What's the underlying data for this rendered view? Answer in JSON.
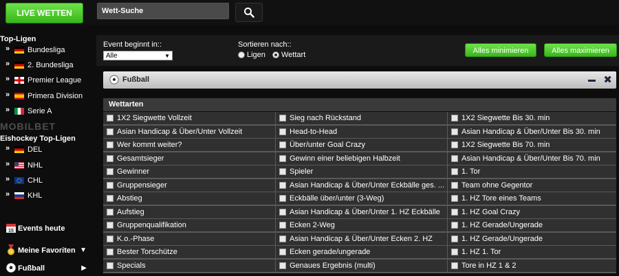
{
  "header": {
    "live_label": "LIVE WETTEN",
    "search_value": "Wett-Suche"
  },
  "sidebar": {
    "top_title": "Top-Ligen",
    "top_items": [
      {
        "label": "Bundesliga",
        "flag": "germany"
      },
      {
        "label": "2. Bundesliga",
        "flag": "germany"
      },
      {
        "label": "Premier League",
        "flag": "england"
      },
      {
        "label": "Primera Division",
        "flag": "spain"
      },
      {
        "label": "Serie A",
        "flag": "italy"
      }
    ],
    "watermark": "MOBILBET",
    "hockey_title": "Eishockey Top-Ligen",
    "hockey_items": [
      {
        "label": "DEL",
        "flag": "germany"
      },
      {
        "label": "NHL",
        "flag": "usa"
      },
      {
        "label": "CHL",
        "flag": "europe"
      },
      {
        "label": "KHL",
        "flag": "russia"
      }
    ],
    "events_today": "Events heute",
    "favorites": "Meine Favoriten",
    "football": "Fußball"
  },
  "filter": {
    "event_label": "Event beginnt in::",
    "event_value": "Alle",
    "sort_label": "Sortieren nach::",
    "radio_ligen": "Ligen",
    "radio_wettart": "Wettart",
    "selected_sort": "Wettart",
    "minimize_all": "Alles minimieren",
    "maximize_all": "Alles maximieren"
  },
  "panel": {
    "title": "Fußball",
    "section_header": "Wettarten",
    "columns": [
      [
        "1X2 Siegwette Vollzeit",
        "Asian Handicap & Über/Unter Vollzeit",
        "Wer kommt weiter?",
        "Gesamtsieger",
        "Gewinner",
        "Gruppensieger",
        "Abstieg",
        "Aufstieg",
        "Gruppenqualifikation",
        "K.o.-Phase",
        "Bester Torschütze",
        "Specials"
      ],
      [
        "Sieg nach Rückstand",
        "Head-to-Head",
        "Über/unter Goal Crazy",
        "Gewinn einer beliebigen Halbzeit",
        "Spieler",
        "Asian Handicap & Über/Unter Eckbälle ges. ...",
        "Eckbälle über/unter (3-Weg)",
        "Asian Handicap & Über/Unter 1. HZ Eckbälle",
        "Ecken 2-Weg",
        "Asian Handicap & Über/Unter Ecken 2. HZ",
        "Ecken gerade/ungerade",
        "Genaues Ergebnis (multi)"
      ],
      [
        "1X2 Siegwette Bis 30. min",
        "Asian Handicap & Über/Unter Bis 30. min",
        "1X2 Siegwette Bis 70. min",
        "Asian Handicap & Über/Unter Bis 70. min",
        "1. Tor",
        "Team ohne Gegentor",
        "1. HZ Tore eines Teams",
        "1. HZ Goal Crazy",
        "1. HZ Gerade/Ungerade",
        "1. HZ Gerade/Ungerade",
        "1. HZ 1. Tor",
        "Tore in HZ 1 & 2"
      ]
    ]
  }
}
